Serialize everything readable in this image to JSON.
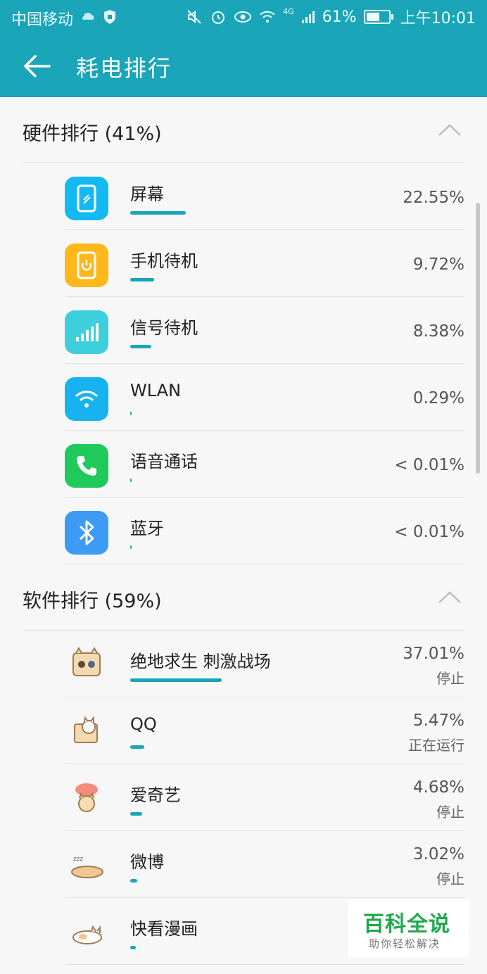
{
  "status_bar": {
    "carrier": "中国移动",
    "network": "4G",
    "battery": "61%",
    "battery_level": 0.61,
    "time": "上午10:01"
  },
  "app_bar": {
    "title": "耗电排行"
  },
  "hardware": {
    "header": "硬件排行 (41%)",
    "items": [
      {
        "name": "屏幕",
        "percent": "22.55%",
        "bar_fraction": 0.61,
        "icon": "phone-screen-icon",
        "color": "#13b9f2"
      },
      {
        "name": "手机待机",
        "percent": "9.72%",
        "bar_fraction": 0.26,
        "icon": "phone-power-icon",
        "color": "#ffb81c"
      },
      {
        "name": "信号待机",
        "percent": "8.38%",
        "bar_fraction": 0.23,
        "icon": "signal-bars-icon",
        "color": "#3ecfdc"
      },
      {
        "name": "WLAN",
        "percent": "0.29%",
        "bar_fraction": 0.01,
        "icon": "wifi-icon",
        "color": "#16b3f0"
      },
      {
        "name": "语音通话",
        "percent": "< 0.01%",
        "bar_fraction": 0.005,
        "icon": "phone-call-icon",
        "color": "#1fc95a"
      },
      {
        "name": "蓝牙",
        "percent": "< 0.01%",
        "bar_fraction": 0.005,
        "icon": "bluetooth-icon",
        "color": "#3d9bf5"
      }
    ]
  },
  "software": {
    "header": "软件排行 (59%)",
    "items": [
      {
        "name": "绝地求生 刺激战场",
        "percent": "37.01%",
        "state": "停止",
        "bar_fraction": 1.0,
        "icon": "cat-box-game-icon"
      },
      {
        "name": "QQ",
        "percent": "5.47%",
        "state": "正在运行",
        "bar_fraction": 0.15,
        "icon": "cat-box-qq-icon"
      },
      {
        "name": "爱奇艺",
        "percent": "4.68%",
        "state": "停止",
        "bar_fraction": 0.13,
        "icon": "cat-cloud-iqiyi-icon"
      },
      {
        "name": "微博",
        "percent": "3.02%",
        "state": "停止",
        "bar_fraction": 0.08,
        "icon": "cat-sleeping-weibo-icon"
      },
      {
        "name": "快看漫画",
        "percent": "",
        "state": "",
        "bar_fraction": 0.06,
        "icon": "cat-lying-kuaikan-icon"
      }
    ]
  },
  "watermark": {
    "title": "百科全说",
    "subtitle": "助你轻松解决"
  },
  "colors": {
    "accent": "#1aa5b8",
    "watermark_green": "#20a84a"
  }
}
